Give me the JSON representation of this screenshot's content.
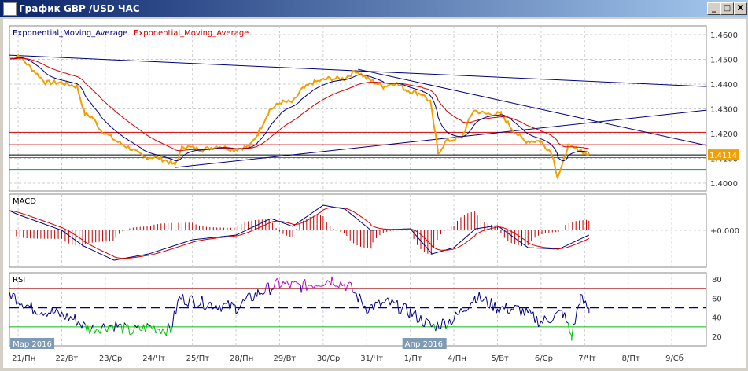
{
  "window": {
    "title": "График GBP /USD  ЧАС",
    "minimize": "_",
    "maximize": "□",
    "close": "X"
  },
  "legend": {
    "ema1": "Exponential_Moving_Average",
    "ema2": "Exponential_Moving_Average"
  },
  "colors": {
    "price": "#f0a000",
    "ema_fast": "#000080",
    "ema_slow": "#d00000",
    "trend": "#000080",
    "level_red": "#d00000",
    "level_green": "#00a050",
    "rsi_over": "#c000c0",
    "rsi_under": "#00c000"
  },
  "chart_data": [
    {
      "type": "line",
      "title": "GBP/USD",
      "yticks": [
        "1.4600",
        "1.4500",
        "1.4400",
        "1.4300",
        "1.4200",
        "1.4100",
        "1.4000"
      ],
      "ylim": [
        1.3965,
        1.4635
      ],
      "current_price": "1.4114",
      "x_labels": [
        "21/Пн",
        "22/Вт",
        "23/Ср",
        "24/Чт",
        "25/Пт",
        "28/Пн",
        "29/Вт",
        "30/Ср",
        "31/Чт",
        "1/Пт",
        "4/Пн",
        "5/Вт",
        "6/Ср",
        "7/Чт",
        "8/Пт",
        "9/Сб"
      ],
      "month_labels": [
        {
          "day": 0,
          "text": "Мар 2016"
        },
        {
          "day": 9,
          "text": "Апр 2016"
        }
      ],
      "price": [
        [
          -0.18,
          1.4502
        ],
        [
          0,
          1.4517
        ],
        [
          0.36,
          1.4454
        ],
        [
          0.63,
          1.4406
        ],
        [
          0.99,
          1.4406
        ],
        [
          1.35,
          1.439
        ],
        [
          1.53,
          1.428
        ],
        [
          1.71,
          1.4265
        ],
        [
          1.89,
          1.4216
        ],
        [
          2.25,
          1.417
        ],
        [
          2.61,
          1.4137
        ],
        [
          2.88,
          1.4105
        ],
        [
          3.15,
          1.4105
        ],
        [
          3.42,
          1.409
        ],
        [
          3.6,
          1.4073
        ],
        [
          3.78,
          1.415
        ],
        [
          4.23,
          1.4135
        ],
        [
          4.59,
          1.415
        ],
        [
          4.95,
          1.4135
        ],
        [
          5.32,
          1.415
        ],
        [
          5.5,
          1.42
        ],
        [
          5.77,
          1.4295
        ],
        [
          6.04,
          1.4327
        ],
        [
          6.31,
          1.4327
        ],
        [
          6.49,
          1.4375
        ],
        [
          6.76,
          1.4406
        ],
        [
          7.12,
          1.4422
        ],
        [
          7.48,
          1.4422
        ],
        [
          7.75,
          1.4454
        ],
        [
          8.02,
          1.4422
        ],
        [
          8.38,
          1.439
        ],
        [
          8.65,
          1.4406
        ],
        [
          8.92,
          1.4375
        ],
        [
          9.28,
          1.4359
        ],
        [
          9.46,
          1.4327
        ],
        [
          9.64,
          1.4121
        ],
        [
          9.82,
          1.417
        ],
        [
          10.18,
          1.4184
        ],
        [
          10.45,
          1.4295
        ],
        [
          10.72,
          1.428
        ],
        [
          11.08,
          1.428
        ],
        [
          11.35,
          1.4216
        ],
        [
          11.62,
          1.417
        ],
        [
          11.98,
          1.417
        ],
        [
          12.25,
          1.4121
        ],
        [
          12.38,
          1.4025
        ],
        [
          12.49,
          1.407
        ],
        [
          12.61,
          1.415
        ],
        [
          12.88,
          1.4135
        ],
        [
          13.1,
          1.4114
        ]
      ],
      "levels": [
        {
          "price": 1.4205,
          "color": "red"
        },
        {
          "price": 1.4155,
          "color": "red"
        },
        {
          "price": 1.4114,
          "color": "black"
        },
        {
          "price": 1.4103,
          "color": "green"
        },
        {
          "price": 1.4055,
          "color": "green"
        }
      ],
      "trendlines": [
        [
          [
            -0.2,
            1.4517
          ],
          [
            15.8,
            1.439
          ]
        ],
        [
          [
            7.8,
            1.446
          ],
          [
            15.8,
            1.4152
          ]
        ],
        [
          [
            3.6,
            1.4063
          ],
          [
            15.8,
            1.4295
          ]
        ]
      ]
    },
    {
      "type": "line",
      "title": "MACD",
      "ytick": "+0.000",
      "ylim": [
        -0.0045,
        0.0045
      ],
      "macd": [
        [
          -0.2,
          0.0025
        ],
        [
          0,
          0.002
        ],
        [
          1,
          0
        ],
        [
          1.5,
          -0.002
        ],
        [
          2.2,
          -0.0038
        ],
        [
          3,
          -0.003
        ],
        [
          4,
          -0.0012
        ],
        [
          5,
          -0.0006
        ],
        [
          5.8,
          0.0015
        ],
        [
          6.3,
          0.0005
        ],
        [
          7,
          0.0032
        ],
        [
          7.5,
          0.0027
        ],
        [
          8.1,
          0
        ],
        [
          9,
          0.0002
        ],
        [
          9.5,
          -0.003
        ],
        [
          10,
          -0.0022
        ],
        [
          10.5,
          0.0002
        ],
        [
          11,
          0.0006
        ],
        [
          11.7,
          -0.0022
        ],
        [
          12.4,
          -0.0024
        ],
        [
          13.1,
          -0.0006
        ]
      ]
    },
    {
      "type": "line",
      "title": "RSI",
      "yticks": [
        "80",
        "60",
        "40",
        "20"
      ],
      "ylim": [
        10,
        88
      ],
      "levels": [
        70,
        50,
        30
      ],
      "rsi": [
        [
          -0.2,
          65
        ],
        [
          0.3,
          50
        ],
        [
          0.8,
          45
        ],
        [
          1.3,
          38
        ],
        [
          1.6,
          28
        ],
        [
          2.2,
          32
        ],
        [
          2.6,
          25
        ],
        [
          3,
          30
        ],
        [
          3.5,
          27
        ],
        [
          3.7,
          60
        ],
        [
          4.3,
          55
        ],
        [
          5,
          50
        ],
        [
          5.5,
          65
        ],
        [
          6,
          75
        ],
        [
          6.5,
          72
        ],
        [
          7.2,
          80
        ],
        [
          7.6,
          72
        ],
        [
          8,
          50
        ],
        [
          8.5,
          55
        ],
        [
          9,
          45
        ],
        [
          9.5,
          30
        ],
        [
          10,
          38
        ],
        [
          10.5,
          62
        ],
        [
          11,
          50
        ],
        [
          11.5,
          48
        ],
        [
          12,
          35
        ],
        [
          12.5,
          45
        ],
        [
          12.7,
          20
        ],
        [
          12.9,
          60
        ],
        [
          13.1,
          48
        ]
      ]
    }
  ]
}
